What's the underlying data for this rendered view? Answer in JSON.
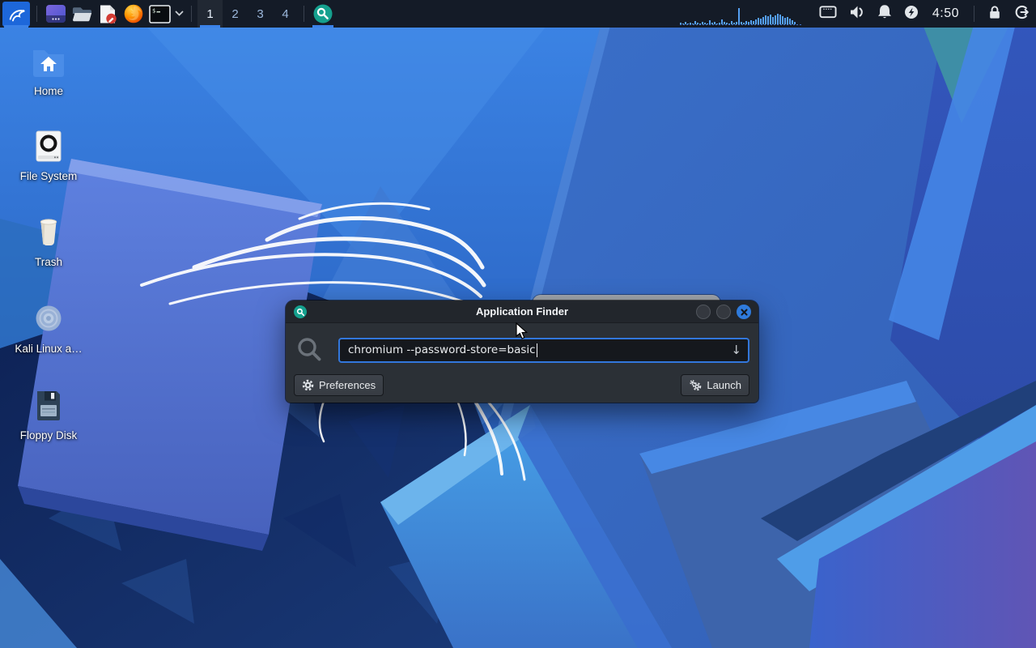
{
  "panel": {
    "launchers": [
      {
        "icon": "kali-menu-icon"
      },
      {
        "icon": "desktop-window-icon"
      },
      {
        "icon": "file-manager-icon"
      },
      {
        "icon": "text-editor-icon"
      },
      {
        "icon": "firefox-icon"
      },
      {
        "icon": "terminal-icon"
      },
      {
        "icon": "launcher-dropdown-chevron-icon"
      }
    ],
    "workspaces": [
      "1",
      "2",
      "3",
      "4"
    ],
    "active_workspace": "1",
    "appfinder_icon": "app-finder-icon",
    "system_monitor": {
      "bars": [
        2,
        1,
        3,
        1,
        2,
        1,
        4,
        2,
        1,
        3,
        2,
        1,
        5,
        2,
        3,
        1,
        2,
        6,
        3,
        2,
        1,
        4,
        2,
        3,
        20,
        3,
        2,
        4,
        3,
        5,
        4,
        6,
        8,
        7,
        9,
        11,
        10,
        12,
        9,
        11,
        13,
        12,
        10,
        8,
        9,
        7,
        5,
        3
      ]
    },
    "tray_icons": [
      "display-icon",
      "volume-icon",
      "notifications-bell-icon",
      "power-manager-icon"
    ],
    "clock": "4:50",
    "session_icons": [
      "lock-icon",
      "logout-icon"
    ]
  },
  "desktop": {
    "icons": [
      {
        "id": "home",
        "label": "Home"
      },
      {
        "id": "filesystem",
        "label": "File System"
      },
      {
        "id": "trash",
        "label": "Trash"
      },
      {
        "id": "kali-cd",
        "label": "Kali Linux a…"
      },
      {
        "id": "floppy",
        "label": "Floppy Disk"
      }
    ]
  },
  "finder": {
    "title": "Application Finder",
    "query": "chromium --password-store=basic",
    "dropdown_glyph": "↓",
    "preferences_label": "Preferences",
    "launch_label": "Launch"
  },
  "colors": {
    "accent_blue": "#3277dc",
    "panel_bg": "#141b27",
    "titlebar_bg": "#22262c",
    "dialog_bg": "#2b3036",
    "input_bg": "#15181d",
    "button_bg": "#3a3f46",
    "teal": "#15a08e"
  }
}
